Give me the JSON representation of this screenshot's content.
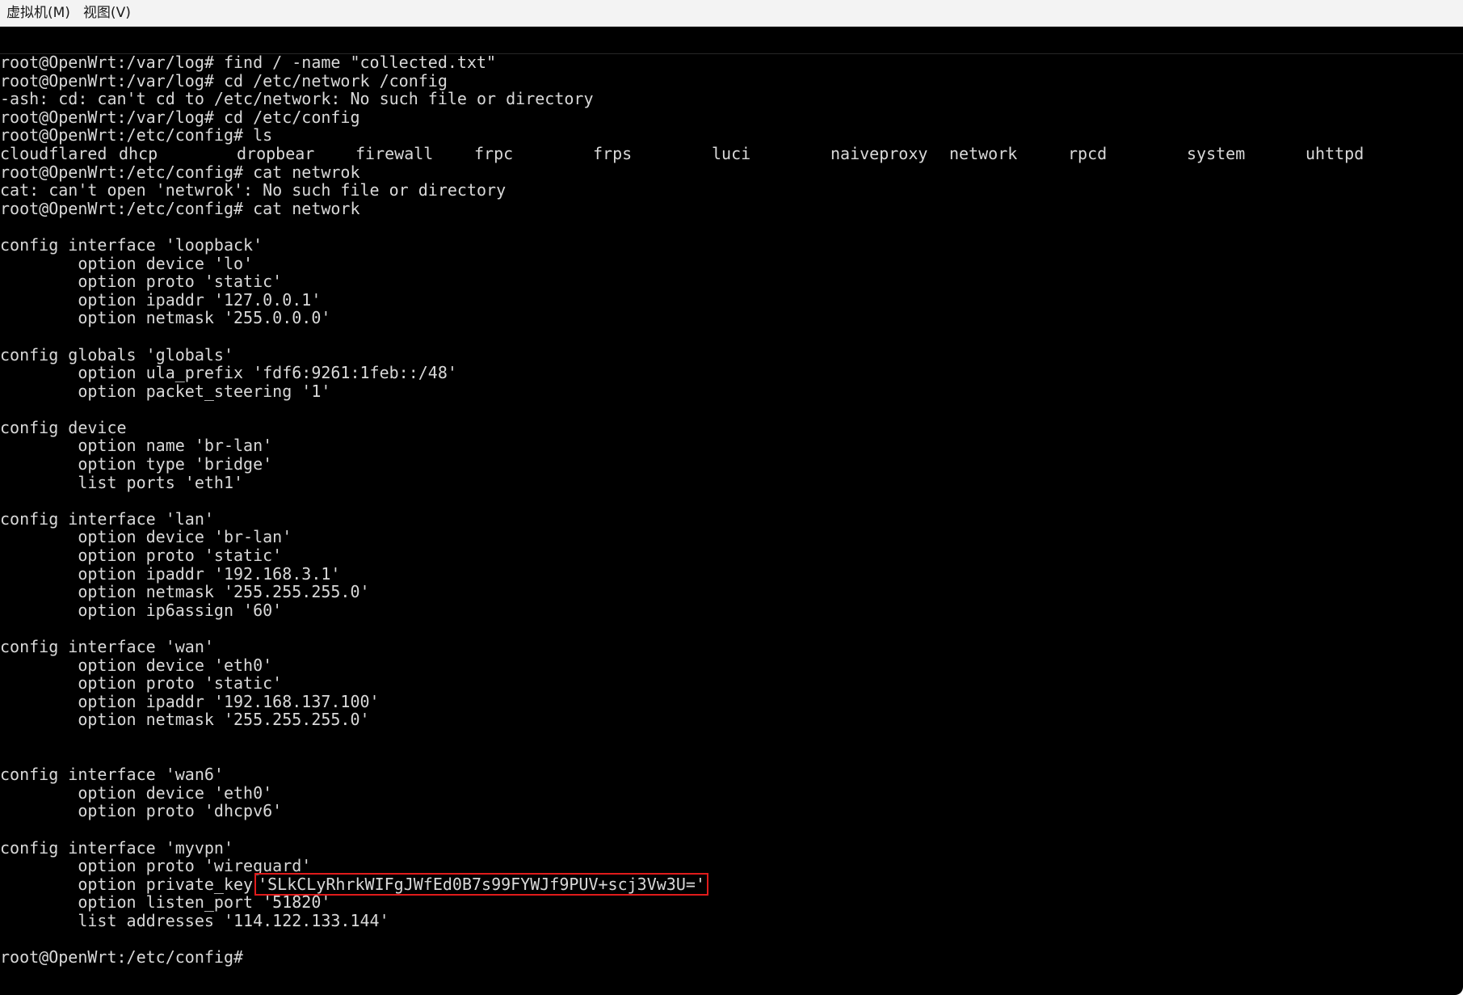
{
  "menubar": {
    "items": [
      {
        "label": "虚拟机(M)"
      },
      {
        "label": "视图(V)"
      }
    ]
  },
  "terminal": {
    "lines": [
      "root@OpenWrt:/var/log# find / -name \"collected.txt\"",
      "root@OpenWrt:/var/log# cd /etc/network /config",
      "-ash: cd: can't cd to /etc/network: No such file or directory",
      "root@OpenWrt:/var/log# cd /etc/config",
      "root@OpenWrt:/etc/config# ls"
    ],
    "ls_output": [
      "cloudflared",
      "dhcp",
      "dropbear",
      "firewall",
      "frpc",
      "frps",
      "luci",
      "naiveproxy",
      "network",
      "rpcd",
      "system",
      "uhttpd"
    ],
    "lines2": [
      "root@OpenWrt:/etc/config# cat netwrok",
      "cat: can't open 'netwrok': No such file or directory",
      "root@OpenWrt:/etc/config# cat network",
      "",
      "config interface 'loopback'",
      "        option device 'lo'",
      "        option proto 'static'",
      "        option ipaddr '127.0.0.1'",
      "        option netmask '255.0.0.0'",
      "",
      "config globals 'globals'",
      "        option ula_prefix 'fdf6:9261:1feb::/48'",
      "        option packet_steering '1'",
      "",
      "config device",
      "        option name 'br-lan'",
      "        option type 'bridge'",
      "        list ports 'eth1'",
      "",
      "config interface 'lan'",
      "        option device 'br-lan'",
      "        option proto 'static'",
      "        option ipaddr '192.168.3.1'",
      "        option netmask '255.255.255.0'",
      "        option ip6assign '60'",
      "",
      "config interface 'wan'",
      "        option device 'eth0'",
      "        option proto 'static'",
      "        option ipaddr '192.168.137.100'",
      "        option netmask '255.255.255.0'",
      "",
      "",
      "config interface 'wan6'",
      "        option device 'eth0'",
      "        option proto 'dhcpv6'",
      "",
      "config interface 'myvpn'",
      "        option proto 'wireguard'"
    ],
    "private_key_prefix": "        option private_key",
    "private_key_value": "'SLkCLyRhrkWIFgJWfEd0B7s99FYWJf9PUV+scj3Vw3U='",
    "lines3": [
      "        option listen_port '51820'",
      "        list addresses '114.122.133.144'",
      "",
      "root@OpenWrt:/etc/config#"
    ]
  },
  "colors": {
    "terminal_bg": "#000000",
    "terminal_fg": "#d9d9d9",
    "highlight_box": "#e01b1b",
    "menubar_bg": "#f3f3f3"
  }
}
